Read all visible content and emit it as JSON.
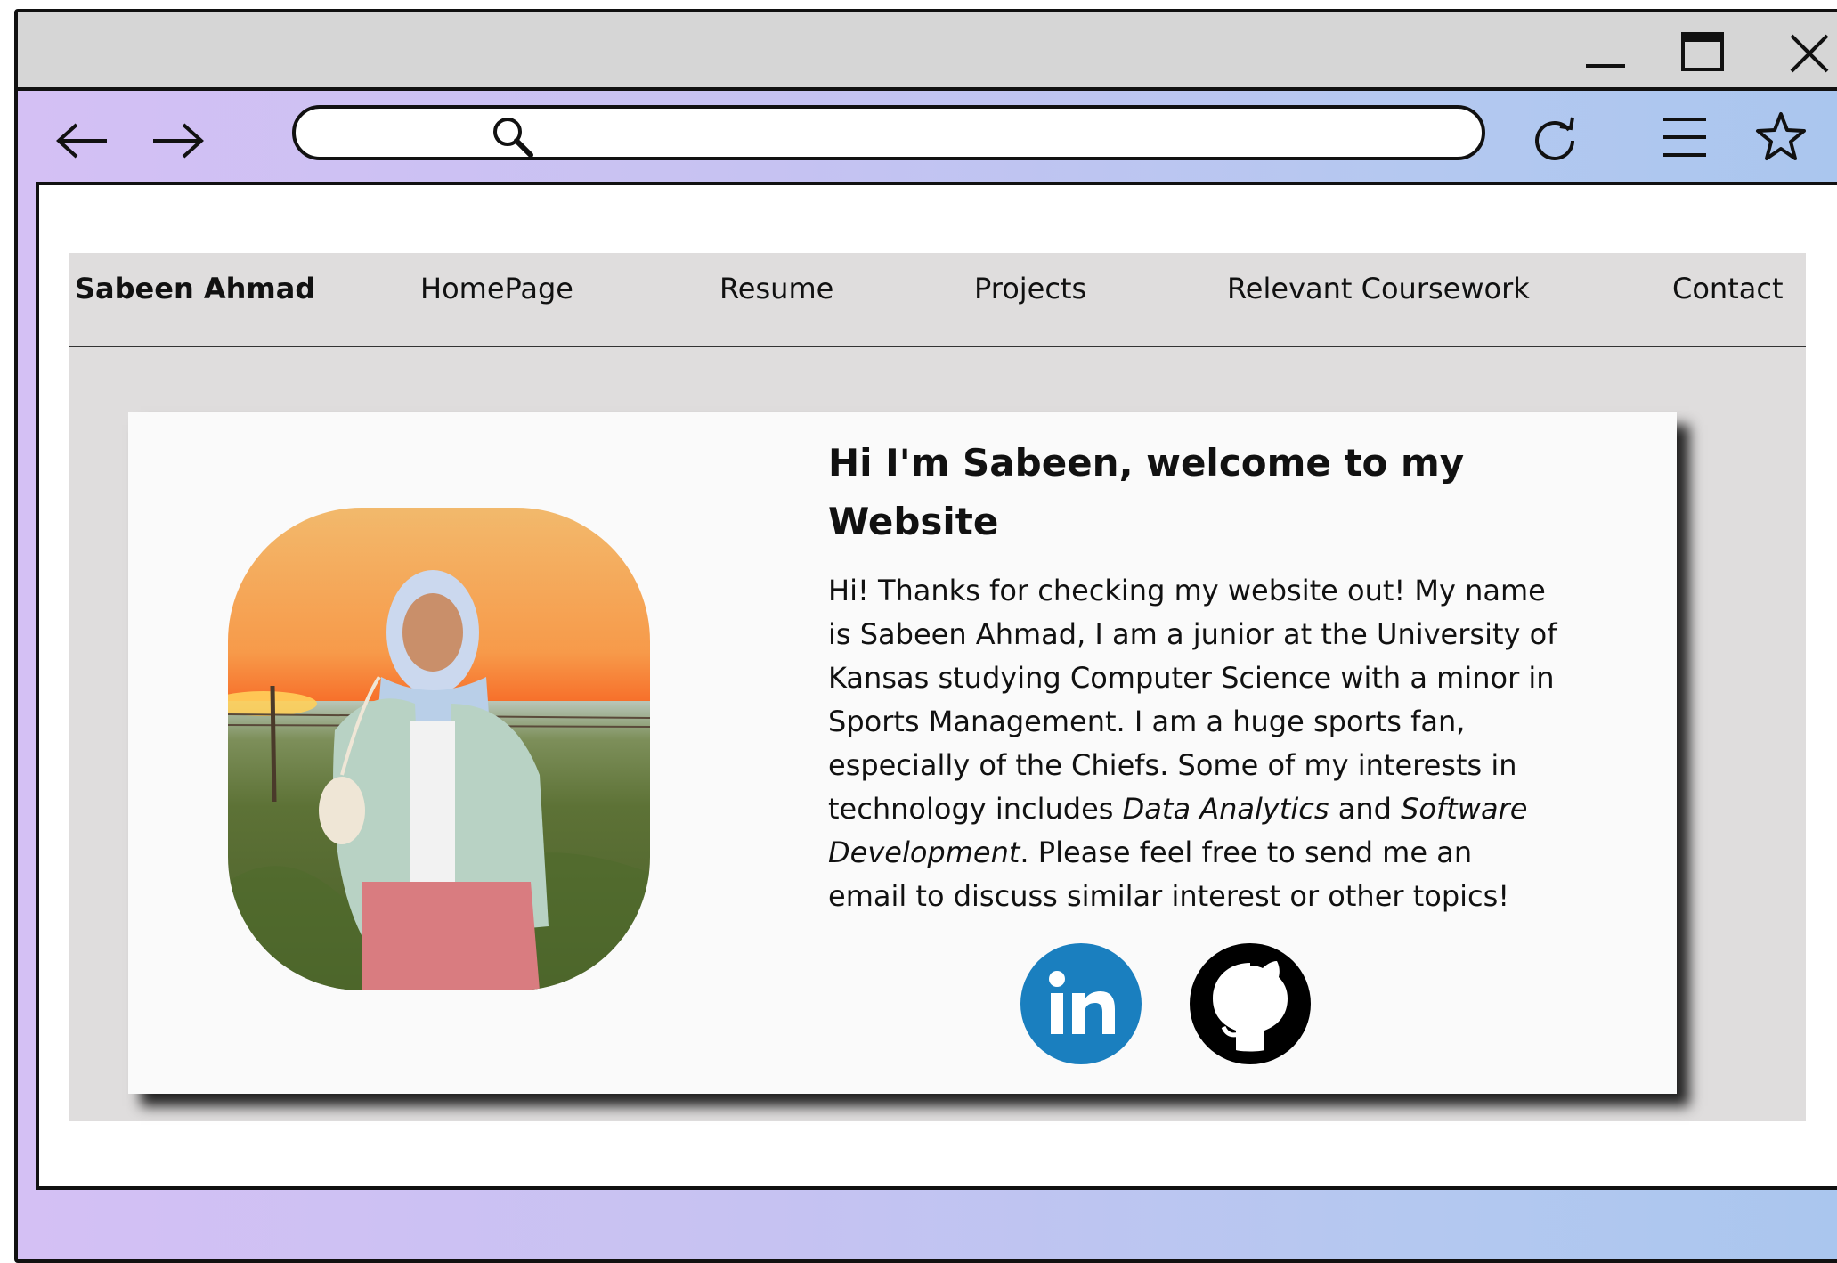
{
  "window": {
    "minimize_icon": "minimize-icon",
    "maximize_icon": "maximize-icon",
    "close_icon": "close-icon"
  },
  "toolbar": {
    "back_icon": "arrow-left-icon",
    "forward_icon": "arrow-right-icon",
    "address_value": "",
    "search_icon": "search-icon",
    "reload_icon": "reload-icon",
    "menu_icon": "hamburger-menu-icon",
    "bookmark_icon": "star-icon"
  },
  "site": {
    "nav": {
      "brand": "Sabeen Ahmad",
      "items": [
        "HomePage",
        "Resume",
        "Projects",
        "Relevant Coursework",
        "Contact"
      ]
    },
    "hero": {
      "greeting": "Hi I'm Sabeen, welcome to my Website",
      "bio": {
        "part1": "Hi! Thanks for checking my website out! My name is Sabeen Ahmad, I am a junior at the University of Kansas studying Computer Science with a minor in Sports Management. I am a huge sports fan, especially of the Chiefs. Some of my interests in technology includes ",
        "em1": "Data Analytics",
        "part2": " and ",
        "em2": "Software Development",
        "part3": ". Please feel free to send me an email to discuss similar interest or other topics!"
      },
      "photo_icon": "profile-photo",
      "social": [
        {
          "icon": "linkedin-icon",
          "color": "#1a7fbf"
        },
        {
          "icon": "github-icon",
          "color": "#000000"
        }
      ]
    }
  },
  "colors": {
    "frame_gradient_start": "#d4c0f4",
    "frame_gradient_end": "#a9c6ee",
    "titlebar": "#d6d6d6",
    "site_bg": "#dfdddd",
    "card_bg": "#fafafa",
    "linkedin_blue": "#1a7fbf"
  }
}
